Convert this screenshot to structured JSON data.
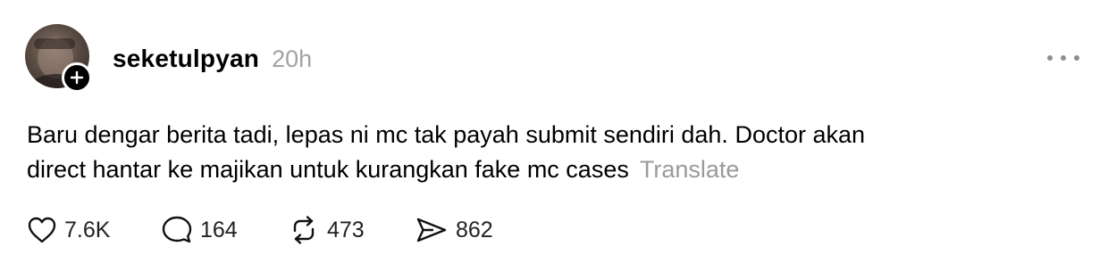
{
  "post": {
    "username": "seketulpyan",
    "timestamp": "20h",
    "body_lines": [
      "Baru dengar berita tadi, lepas ni mc tak payah submit sendiri dah. Doctor akan",
      "direct hantar ke majikan untuk kurangkan fake mc cases"
    ],
    "translate_label": "Translate",
    "actions": {
      "like_count": "7.6K",
      "reply_count": "164",
      "repost_count": "473",
      "share_count": "862"
    }
  },
  "icons": {
    "avatar": "user-avatar",
    "follow": "plus-icon",
    "more": "more-dots-icon",
    "like": "heart-icon",
    "reply": "comment-bubble-icon",
    "repost": "repost-arrows-icon",
    "share": "send-icon"
  }
}
